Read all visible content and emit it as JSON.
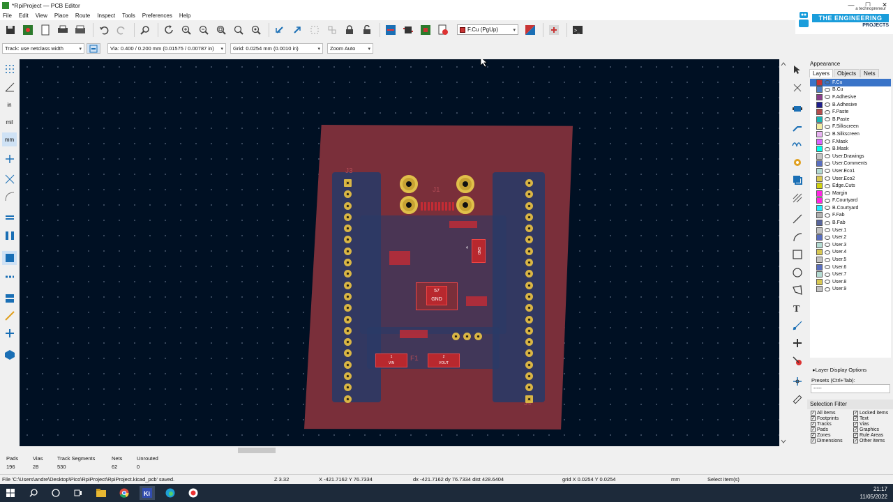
{
  "window": {
    "title": "*RpiProject — PCB Editor",
    "minimize": "—",
    "maximize": "☐",
    "close": "✕"
  },
  "menu": [
    "File",
    "Edit",
    "View",
    "Place",
    "Route",
    "Inspect",
    "Tools",
    "Preferences",
    "Help"
  ],
  "brand": {
    "tagline": "a technopreneur",
    "name": "THE ENGINEERING",
    "sub": "PROJECTS"
  },
  "toolbar": {
    "active_layer": "F.Cu (PgUp)",
    "track": "Track: use netclass width",
    "via": "Via: 0.400 / 0.200 mm (0.01575 / 0.00787 in)",
    "grid": "Grid: 0.0254 mm (0.0010 in)",
    "zoom": "Zoom Auto"
  },
  "left_toolbar": {
    "in": "in",
    "mil": "mil",
    "mm": "mm"
  },
  "board": {
    "chip_label_top": "57",
    "chip_label_bottom": "GND",
    "j1": "J1",
    "j3": "J3",
    "j4": "J4",
    "f1": "F1",
    "pad_vin": "VIN",
    "pad_vin_num": "1",
    "pad_vout": "VOUT",
    "pad_vout_num": "2",
    "u_gnd": "GND",
    "u_num": "4"
  },
  "appearance": {
    "title": "Appearance",
    "tabs": [
      "Layers",
      "Objects",
      "Nets"
    ],
    "layers": [
      {
        "name": "F.Cu",
        "color": "#c83434"
      },
      {
        "name": "B.Cu",
        "color": "#4d7fc4"
      },
      {
        "name": "F.Adhesive",
        "color": "#8a3d8a"
      },
      {
        "name": "B.Adhesive",
        "color": "#1e1e8c"
      },
      {
        "name": "F.Paste",
        "color": "#b44c4c"
      },
      {
        "name": "B.Paste",
        "color": "#1ab4b4"
      },
      {
        "name": "F.Silkscreen",
        "color": "#f2eda1"
      },
      {
        "name": "B.Silkscreen",
        "color": "#e8b2f2"
      },
      {
        "name": "F.Mask",
        "color": "#d864ff"
      },
      {
        "name": "B.Mask",
        "color": "#02ffee"
      },
      {
        "name": "User.Drawings",
        "color": "#c2c2c2"
      },
      {
        "name": "User.Comments",
        "color": "#596ebf"
      },
      {
        "name": "User.Eco1",
        "color": "#b4dbd2"
      },
      {
        "name": "User.Eco2",
        "color": "#d8c852"
      },
      {
        "name": "Edge.Cuts",
        "color": "#d0d210"
      },
      {
        "name": "Margin",
        "color": "#ff26e2"
      },
      {
        "name": "F.Courtyard",
        "color": "#ff26e2"
      },
      {
        "name": "B.Courtyard",
        "color": "#26e9ff"
      },
      {
        "name": "F.Fab",
        "color": "#afafaf"
      },
      {
        "name": "B.Fab",
        "color": "#58659b"
      },
      {
        "name": "User.1",
        "color": "#c2c2c2"
      },
      {
        "name": "User.2",
        "color": "#596ebf"
      },
      {
        "name": "User.3",
        "color": "#b4dbd2"
      },
      {
        "name": "User.4",
        "color": "#d8c852"
      },
      {
        "name": "User.5",
        "color": "#c2c2c2"
      },
      {
        "name": "User.6",
        "color": "#596ebf"
      },
      {
        "name": "User.7",
        "color": "#b4dbd2"
      },
      {
        "name": "User.8",
        "color": "#d8c852"
      },
      {
        "name": "User.9",
        "color": "#c2c2c2"
      }
    ],
    "layer_options": "▸Layer Display Options",
    "presets_label": "Presets (Ctrl+Tab):",
    "presets_value": "-----"
  },
  "selection_filter": {
    "title": "Selection Filter",
    "items": [
      "All items",
      "Locked items",
      "Footprints",
      "Text",
      "Tracks",
      "Vias",
      "Pads",
      "Graphics",
      "Zones",
      "Rule Areas",
      "Dimensions",
      "Other items"
    ]
  },
  "stats": [
    {
      "label": "Pads",
      "value": "196"
    },
    {
      "label": "Vias",
      "value": "28"
    },
    {
      "label": "Track Segments",
      "value": "530"
    },
    {
      "label": "Nets",
      "value": "62"
    },
    {
      "label": "Unrouted",
      "value": "0"
    }
  ],
  "status": {
    "file": "File 'C:\\Users\\andre\\Desktop\\Pico\\RpiProject\\RpiProject.kicad_pcb' saved.",
    "zoom": "Z 3.32",
    "xy": "X -421.7162  Y 76.7334",
    "dxy": "dx -421.7162  dy 76.7334  dist 428.6404",
    "grid": "grid X 0.0254  Y 0.0254",
    "units": "mm",
    "mode": "Select item(s)"
  },
  "taskbar": {
    "time": "21:17",
    "date": "11/05/2022"
  }
}
